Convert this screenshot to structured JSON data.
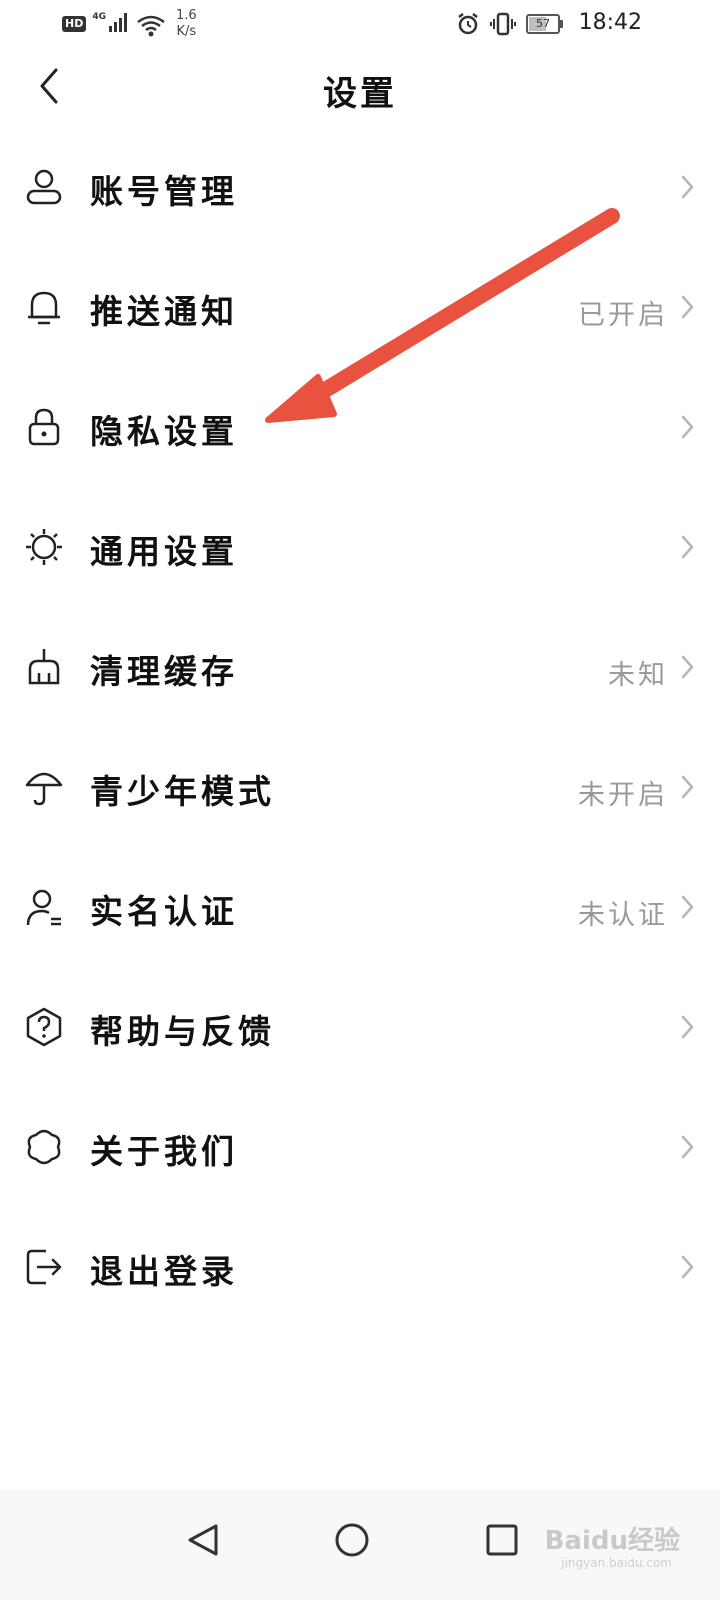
{
  "status_bar": {
    "hd": "HD",
    "network": "4G",
    "speed_value": "1.6",
    "speed_unit": "K/s",
    "battery": "57",
    "battery_level": 0.57,
    "time": "18:42"
  },
  "header": {
    "title": "设置",
    "back_icon": "chevron-left-icon"
  },
  "menu": [
    {
      "label": "账号管理",
      "value": "",
      "icon": "user-icon"
    },
    {
      "label": "推送通知",
      "value": "已开启",
      "icon": "bell-icon"
    },
    {
      "label": "隐私设置",
      "value": "",
      "icon": "lock-icon"
    },
    {
      "label": "通用设置",
      "value": "",
      "icon": "sun-icon"
    },
    {
      "label": "清理缓存",
      "value": "未知",
      "icon": "broom-icon"
    },
    {
      "label": "青少年模式",
      "value": "未开启",
      "icon": "umbrella-icon"
    },
    {
      "label": "实名认证",
      "value": "未认证",
      "icon": "user-id-icon"
    },
    {
      "label": "帮助与反馈",
      "value": "",
      "icon": "help-icon"
    },
    {
      "label": "关于我们",
      "value": "",
      "icon": "flower-icon"
    },
    {
      "label": "退出登录",
      "value": "",
      "icon": "logout-icon"
    }
  ],
  "annotation": {
    "arrow_color": "#e8523f"
  },
  "watermark": {
    "brand": "Baidu经验",
    "url": "jingyan.baidu.com"
  }
}
